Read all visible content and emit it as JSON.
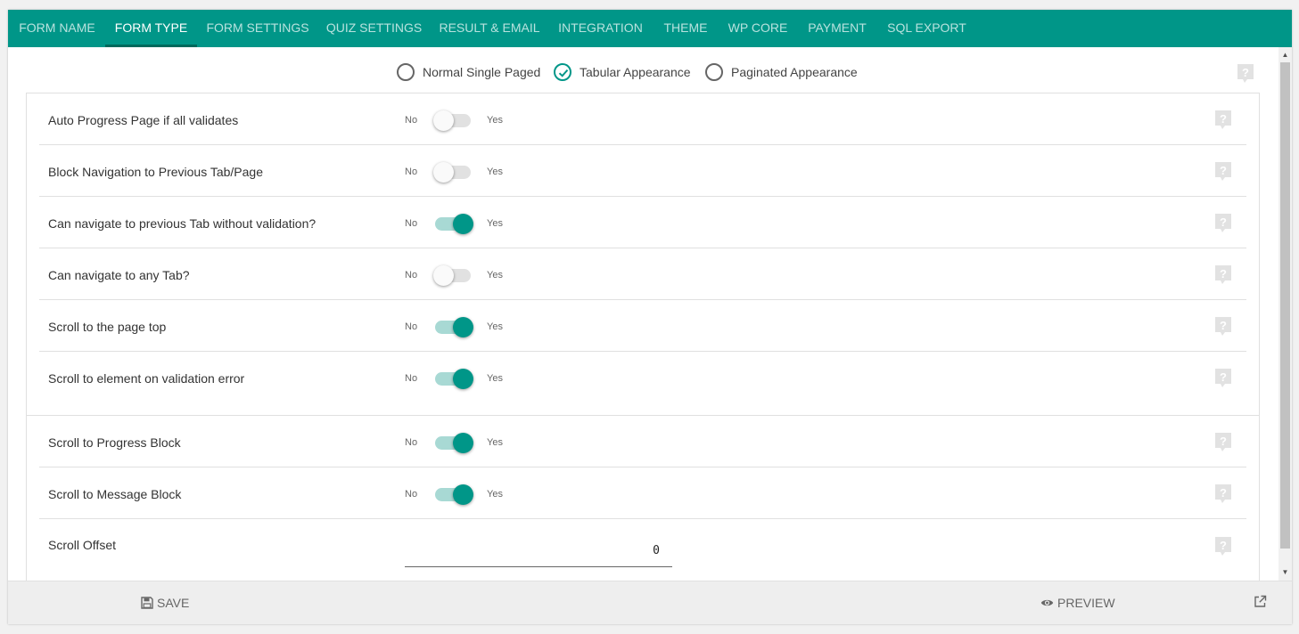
{
  "tabs": [
    {
      "label": "FORM NAME"
    },
    {
      "label": "FORM TYPE"
    },
    {
      "label": "FORM SETTINGS"
    },
    {
      "label": "QUIZ SETTINGS"
    },
    {
      "label": "RESULT & EMAIL"
    },
    {
      "label": "INTEGRATION"
    },
    {
      "label": "THEME"
    },
    {
      "label": "WP CORE"
    },
    {
      "label": "PAYMENT"
    },
    {
      "label": "SQL EXPORT"
    }
  ],
  "active_tab": "FORM TYPE",
  "form_type": {
    "options": [
      {
        "label": "Normal Single Paged"
      },
      {
        "label": "Tabular Appearance"
      },
      {
        "label": "Paginated Appearance"
      }
    ],
    "selected": "Tabular Appearance"
  },
  "toggle_labels": {
    "no": "No",
    "yes": "Yes"
  },
  "settings": [
    {
      "label": "Auto Progress Page if all validates",
      "value": false
    },
    {
      "label": "Block Navigation to Previous Tab/Page",
      "value": false
    },
    {
      "label": "Can navigate to previous Tab without validation?",
      "value": true
    },
    {
      "label": "Can navigate to any Tab?",
      "value": false
    },
    {
      "label": "Scroll to the page top",
      "value": true
    },
    {
      "label": "Scroll to element on validation error",
      "value": true
    },
    {
      "label": "Scroll to Progress Block",
      "value": true
    },
    {
      "label": "Scroll to Message Block",
      "value": true
    }
  ],
  "scroll_offset": {
    "label": "Scroll Offset",
    "value": "0"
  },
  "footer": {
    "save_label": "SAVE",
    "preview_label": "PREVIEW"
  },
  "colors": {
    "accent": "#009688",
    "accent_dark": "#00695c",
    "switch_track_on": "#a8d9d4"
  },
  "icons": {
    "help": "help-bubble-icon",
    "save": "floppy-disk-icon",
    "preview": "eye-icon",
    "external": "external-link-icon",
    "radio_checked": "check-icon"
  }
}
